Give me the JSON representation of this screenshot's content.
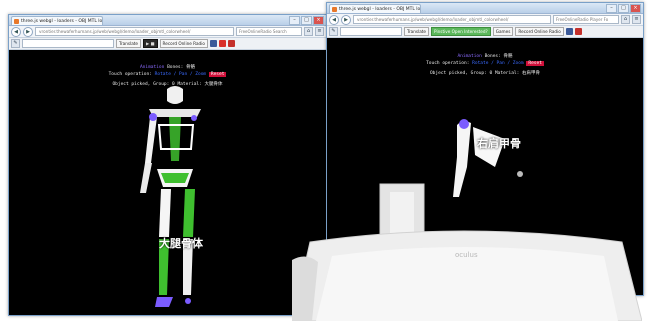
{
  "left_window": {
    "tab_title": "three.js webgl - loaders - OBJ MTL lo",
    "url": "vrontier.thewaferhumans.jp/web/webgl/demo/loader_objmtl_colorwheel/",
    "search_placeholder": "FreeOnlineRadio Search",
    "toolbar": {
      "translate_label": "Translate",
      "radio_label": "Record Online Radio"
    },
    "overlay": {
      "line1_prefix": "Animation",
      "line1_label": "Bones: 骨骼",
      "line2_label": "Touch operation:",
      "line2_mode": "Rotate / Pan / Zoom",
      "line2_reset": "Reset",
      "line3": "Object picked, Group: 0 Material: 大腿骨体"
    },
    "bone_label": "大腿骨体"
  },
  "right_window": {
    "tab_title": "three.js webgl - loaders - OBJ MTL lo",
    "url": "vrontier.thewaferhumans.jp/web/webgl/demo/loader_objmtl_colorwheel/",
    "search_placeholder": "FreeOnlineRadio Player Fo",
    "toolbar": {
      "translate_label": "Translate",
      "promo_label": "Pinstive Open Interested?",
      "games_label": "Games",
      "radio_label": "Record Online Radio"
    },
    "overlay": {
      "line1_prefix": "Animation",
      "line1_label": "Bones: 骨骼",
      "line2_label": "Touch operation:",
      "line2_mode": "Rotate / Pan / Zoom",
      "line2_reset": "Reset",
      "line3": "Object picked, Group: 0 Material: 右肩甲骨"
    },
    "bone_label": "右肩甲骨"
  },
  "headset": {
    "brand": "oculus"
  },
  "colors": {
    "viewport_bg": "#000000",
    "bone_white": "#f4f4f4",
    "highlight_green": "#3fbf2f",
    "highlight_purple": "#7b5cff",
    "reset_red": "#d0103a"
  }
}
